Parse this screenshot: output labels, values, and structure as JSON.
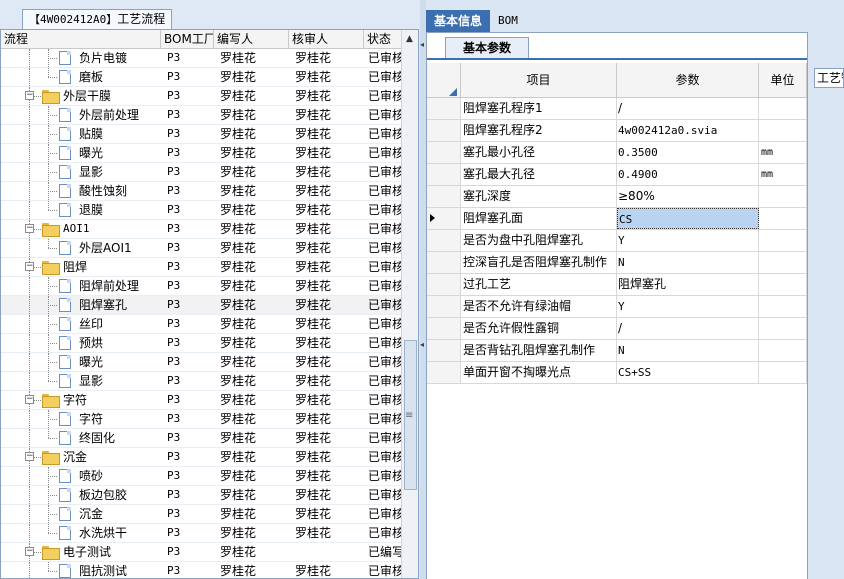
{
  "left_panel": {
    "tab_code": "【4W002412A0】",
    "tab_label": "工艺流程",
    "columns": [
      "流程",
      "BOM工厂",
      "编写人",
      "核审人",
      "状态"
    ],
    "rows": [
      {
        "label": "负片电镀",
        "level": 2,
        "type": "doc",
        "bom": "P3",
        "writer": "罗桂花",
        "reviewer": "罗桂花",
        "status": "已审核"
      },
      {
        "label": "磨板",
        "level": 2,
        "type": "doc",
        "bom": "P3",
        "writer": "罗桂花",
        "reviewer": "罗桂花",
        "status": "已审核"
      },
      {
        "label": "外层干膜",
        "level": 1,
        "type": "folder",
        "bom": "P3",
        "writer": "罗桂花",
        "reviewer": "罗桂花",
        "status": "已审核"
      },
      {
        "label": "外层前处理",
        "level": 2,
        "type": "doc",
        "bom": "P3",
        "writer": "罗桂花",
        "reviewer": "罗桂花",
        "status": "已审核"
      },
      {
        "label": "贴膜",
        "level": 2,
        "type": "doc",
        "bom": "P3",
        "writer": "罗桂花",
        "reviewer": "罗桂花",
        "status": "已审核"
      },
      {
        "label": "曝光",
        "level": 2,
        "type": "doc",
        "bom": "P3",
        "writer": "罗桂花",
        "reviewer": "罗桂花",
        "status": "已审核"
      },
      {
        "label": "显影",
        "level": 2,
        "type": "doc",
        "bom": "P3",
        "writer": "罗桂花",
        "reviewer": "罗桂花",
        "status": "已审核"
      },
      {
        "label": "酸性蚀刻",
        "level": 2,
        "type": "doc",
        "bom": "P3",
        "writer": "罗桂花",
        "reviewer": "罗桂花",
        "status": "已审核"
      },
      {
        "label": "退膜",
        "level": 2,
        "type": "doc",
        "bom": "P3",
        "writer": "罗桂花",
        "reviewer": "罗桂花",
        "status": "已审核"
      },
      {
        "label": "AOI1",
        "level": 1,
        "type": "folder",
        "bom": "P3",
        "writer": "罗桂花",
        "reviewer": "罗桂花",
        "status": "已审核"
      },
      {
        "label": "外层AOI1",
        "level": 2,
        "type": "doc",
        "bom": "P3",
        "writer": "罗桂花",
        "reviewer": "罗桂花",
        "status": "已审核"
      },
      {
        "label": "阻焊",
        "level": 1,
        "type": "folder",
        "bom": "P3",
        "writer": "罗桂花",
        "reviewer": "罗桂花",
        "status": "已审核"
      },
      {
        "label": "阻焊前处理",
        "level": 2,
        "type": "doc",
        "bom": "P3",
        "writer": "罗桂花",
        "reviewer": "罗桂花",
        "status": "已审核"
      },
      {
        "label": "阻焊塞孔",
        "level": 2,
        "type": "doc",
        "bom": "P3",
        "writer": "罗桂花",
        "reviewer": "罗桂花",
        "status": "已审核",
        "selected": true
      },
      {
        "label": "丝印",
        "level": 2,
        "type": "doc",
        "bom": "P3",
        "writer": "罗桂花",
        "reviewer": "罗桂花",
        "status": "已审核"
      },
      {
        "label": "预烘",
        "level": 2,
        "type": "doc",
        "bom": "P3",
        "writer": "罗桂花",
        "reviewer": "罗桂花",
        "status": "已审核"
      },
      {
        "label": "曝光",
        "level": 2,
        "type": "doc",
        "bom": "P3",
        "writer": "罗桂花",
        "reviewer": "罗桂花",
        "status": "已审核"
      },
      {
        "label": "显影",
        "level": 2,
        "type": "doc",
        "bom": "P3",
        "writer": "罗桂花",
        "reviewer": "罗桂花",
        "status": "已审核"
      },
      {
        "label": "字符",
        "level": 1,
        "type": "folder",
        "bom": "P3",
        "writer": "罗桂花",
        "reviewer": "罗桂花",
        "status": "已审核"
      },
      {
        "label": "字符",
        "level": 2,
        "type": "doc",
        "bom": "P3",
        "writer": "罗桂花",
        "reviewer": "罗桂花",
        "status": "已审核"
      },
      {
        "label": "终固化",
        "level": 2,
        "type": "doc",
        "bom": "P3",
        "writer": "罗桂花",
        "reviewer": "罗桂花",
        "status": "已审核"
      },
      {
        "label": "沉金",
        "level": 1,
        "type": "folder",
        "bom": "P3",
        "writer": "罗桂花",
        "reviewer": "罗桂花",
        "status": "已审核"
      },
      {
        "label": "喷砂",
        "level": 2,
        "type": "doc",
        "bom": "P3",
        "writer": "罗桂花",
        "reviewer": "罗桂花",
        "status": "已审核"
      },
      {
        "label": "板边包胶",
        "level": 2,
        "type": "doc",
        "bom": "P3",
        "writer": "罗桂花",
        "reviewer": "罗桂花",
        "status": "已审核"
      },
      {
        "label": "沉金",
        "level": 2,
        "type": "doc",
        "bom": "P3",
        "writer": "罗桂花",
        "reviewer": "罗桂花",
        "status": "已审核"
      },
      {
        "label": "水洗烘干",
        "level": 2,
        "type": "doc",
        "bom": "P3",
        "writer": "罗桂花",
        "reviewer": "罗桂花",
        "status": "已审核"
      },
      {
        "label": "电子测试",
        "level": 1,
        "type": "folder",
        "bom": "P3",
        "writer": "罗桂花",
        "reviewer": "",
        "status": "已编写"
      },
      {
        "label": "阻抗测试",
        "level": 2,
        "type": "doc",
        "bom": "P3",
        "writer": "罗桂花",
        "reviewer": "罗桂花",
        "status": "已审核"
      }
    ]
  },
  "right_panel": {
    "tabs": [
      {
        "label": "基本信息",
        "active": true
      },
      {
        "label": "BOM",
        "active": false
      }
    ],
    "sub_tab": "基本参数",
    "far_tab": "工艺智",
    "grid_columns": [
      "项目",
      "参数",
      "单位"
    ],
    "params": [
      {
        "item": "阻焊塞孔程序1",
        "value": "/",
        "unit": "",
        "mono": false
      },
      {
        "item": "阻焊塞孔程序2",
        "value": "4w002412a0.svia",
        "unit": "",
        "mono": true
      },
      {
        "item": "塞孔最小孔径",
        "value": "0.3500",
        "unit": "mm",
        "mono": true
      },
      {
        "item": "塞孔最大孔径",
        "value": "0.4900",
        "unit": "mm",
        "mono": true
      },
      {
        "item": "塞孔深度",
        "value": "≥80%",
        "unit": "",
        "mono": false
      },
      {
        "item": "阻焊塞孔面",
        "value": "CS",
        "unit": "",
        "mono": true,
        "current": true
      },
      {
        "item": "是否为盘中孔阻焊塞孔",
        "value": "Y",
        "unit": "",
        "mono": true
      },
      {
        "item": "控深盲孔是否阻焊塞孔制作",
        "value": "N",
        "unit": "",
        "mono": true
      },
      {
        "item": "过孔工艺",
        "value": "阻焊塞孔",
        "unit": "",
        "mono": false
      },
      {
        "item": "是否不允许有绿油帽",
        "value": "Y",
        "unit": "",
        "mono": true
      },
      {
        "item": "是否允许假性露铜",
        "value": "/",
        "unit": "",
        "mono": false
      },
      {
        "item": "是否背钻孔阻焊塞孔制作",
        "value": "N",
        "unit": "",
        "mono": true
      },
      {
        "item": "单面开窗不掏曝光点",
        "value": "CS+SS",
        "unit": "",
        "mono": true
      }
    ]
  },
  "colors": {
    "accent": "#3c6fb0",
    "folder": "#f3cf5e",
    "selected_cell": "#b9d3f1",
    "panel_bg": "#dbe6f4"
  }
}
